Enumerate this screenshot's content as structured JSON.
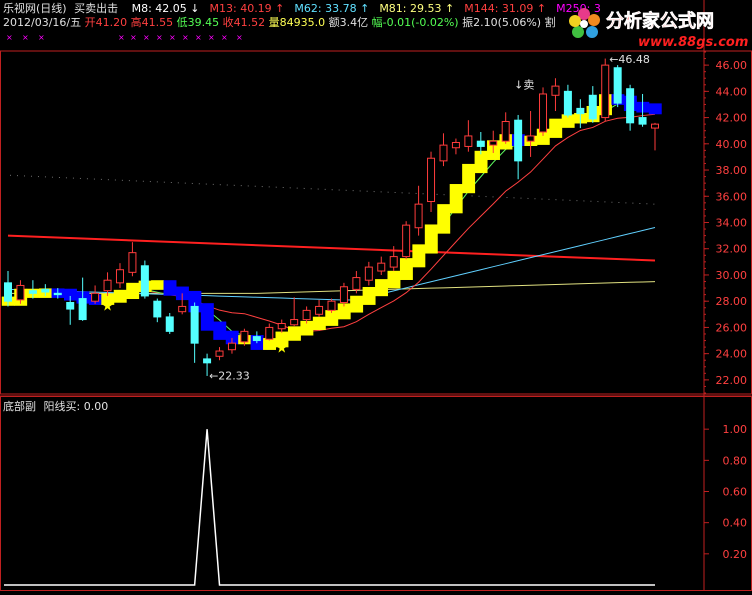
{
  "header": {
    "title": "乐视网(日线)",
    "indicator_name": "买卖出击",
    "ma": [
      {
        "label": "M8: 42.05",
        "arrow": "↓",
        "color": "#ffffff"
      },
      {
        "label": "M13: 40.19",
        "arrow": "↑",
        "color": "#ff4040"
      },
      {
        "label": "M62: 33.78",
        "arrow": "↑",
        "color": "#60e0ff"
      },
      {
        "label": "M81: 29.53",
        "arrow": "↑",
        "color": "#ffff80"
      },
      {
        "label": "M144: 31.09",
        "arrow": "↑",
        "color": "#ff4040"
      },
      {
        "label": "M250: 3",
        "arrow": "",
        "color": "#ff00ff"
      }
    ],
    "quote": {
      "date": "2012/03/16/五",
      "open": "开41.20",
      "high": "高41.55",
      "low": "低39.45",
      "close": "收41.52",
      "volume": "量84935.0",
      "amount": "额3.4亿",
      "change": "幅-0.01(-0.02%)",
      "amplitude": "振2.10(5.06%)",
      "tail": "割"
    }
  },
  "logo": {
    "text": "分析家公式网",
    "url": "www.88gs.com"
  },
  "annotations": {
    "high_label": "46.48",
    "low_label": "22.33",
    "sell_label": "↓卖",
    "star_glyph": "★"
  },
  "sub_panel": {
    "title": "底部副",
    "line_name": "阳线买",
    "value": "0.00"
  },
  "colors": {
    "up_candle": "#ff3c3c",
    "down_candle": "#54ffff",
    "axis": "#c02020",
    "ribbon_up": "#ffff00",
    "ribbon_down": "#0000ff",
    "ma144": "#ff2020",
    "ma62": "#60d0ff",
    "ma81": "#e0e080",
    "ma13": "#ff4040",
    "ma8": "#60ff60"
  },
  "chart_data": {
    "type": "candlestick",
    "ylim": [
      21.0,
      47.0
    ],
    "y_ticks": [
      "22.00",
      "24.00",
      "26.00",
      "28.00",
      "30.00",
      "32.00",
      "34.00",
      "36.00",
      "38.00",
      "40.00",
      "42.00",
      "44.00",
      "46.00"
    ],
    "candles": [
      {
        "o": 29.4,
        "h": 30.3,
        "l": 27.6,
        "c": 28.0
      },
      {
        "o": 28.1,
        "h": 29.6,
        "l": 27.8,
        "c": 29.2
      },
      {
        "o": 28.8,
        "h": 29.6,
        "l": 28.2,
        "c": 28.6
      },
      {
        "o": 28.9,
        "h": 29.3,
        "l": 28.4,
        "c": 28.7
      },
      {
        "o": 28.6,
        "h": 29.0,
        "l": 28.2,
        "c": 28.5
      },
      {
        "o": 27.9,
        "h": 28.4,
        "l": 26.2,
        "c": 27.4
      },
      {
        "o": 28.2,
        "h": 29.8,
        "l": 26.5,
        "c": 26.6
      },
      {
        "o": 28.0,
        "h": 29.2,
        "l": 27.8,
        "c": 28.6
      },
      {
        "o": 28.8,
        "h": 30.2,
        "l": 28.4,
        "c": 29.6
      },
      {
        "o": 29.4,
        "h": 30.9,
        "l": 29.0,
        "c": 30.4
      },
      {
        "o": 30.2,
        "h": 32.5,
        "l": 29.9,
        "c": 31.7
      },
      {
        "o": 30.7,
        "h": 31.1,
        "l": 28.2,
        "c": 28.4
      },
      {
        "o": 28.0,
        "h": 28.2,
        "l": 26.4,
        "c": 26.8
      },
      {
        "o": 26.8,
        "h": 27.1,
        "l": 25.5,
        "c": 25.7
      },
      {
        "o": 27.2,
        "h": 28.6,
        "l": 27.0,
        "c": 27.6
      },
      {
        "o": 27.6,
        "h": 27.9,
        "l": 23.3,
        "c": 24.8
      },
      {
        "o": 23.6,
        "h": 24.0,
        "l": 22.3,
        "c": 23.3
      },
      {
        "o": 23.8,
        "h": 24.5,
        "l": 23.5,
        "c": 24.2
      },
      {
        "o": 24.3,
        "h": 25.2,
        "l": 24.0,
        "c": 24.8
      },
      {
        "o": 24.9,
        "h": 25.9,
        "l": 24.6,
        "c": 25.7
      },
      {
        "o": 25.3,
        "h": 25.7,
        "l": 24.8,
        "c": 25.0
      },
      {
        "o": 25.1,
        "h": 26.3,
        "l": 25.0,
        "c": 26.0
      },
      {
        "o": 25.9,
        "h": 26.6,
        "l": 25.6,
        "c": 26.3
      },
      {
        "o": 26.2,
        "h": 28.3,
        "l": 26.1,
        "c": 26.6
      },
      {
        "o": 26.6,
        "h": 27.6,
        "l": 26.3,
        "c": 27.3
      },
      {
        "o": 27.0,
        "h": 28.1,
        "l": 26.8,
        "c": 27.6
      },
      {
        "o": 27.3,
        "h": 28.2,
        "l": 27.1,
        "c": 28.0
      },
      {
        "o": 27.9,
        "h": 29.4,
        "l": 27.6,
        "c": 29.1
      },
      {
        "o": 28.9,
        "h": 30.3,
        "l": 28.6,
        "c": 29.8
      },
      {
        "o": 29.6,
        "h": 31.0,
        "l": 29.2,
        "c": 30.6
      },
      {
        "o": 30.3,
        "h": 31.4,
        "l": 30.0,
        "c": 30.9
      },
      {
        "o": 30.6,
        "h": 32.2,
        "l": 30.3,
        "c": 31.4
      },
      {
        "o": 31.4,
        "h": 34.1,
        "l": 31.2,
        "c": 33.8
      },
      {
        "o": 33.6,
        "h": 36.8,
        "l": 33.0,
        "c": 35.4
      },
      {
        "o": 35.6,
        "h": 39.4,
        "l": 34.8,
        "c": 38.9
      },
      {
        "o": 38.7,
        "h": 40.8,
        "l": 38.3,
        "c": 39.9
      },
      {
        "o": 39.7,
        "h": 40.4,
        "l": 39.2,
        "c": 40.1
      },
      {
        "o": 39.8,
        "h": 41.8,
        "l": 39.4,
        "c": 40.6
      },
      {
        "o": 40.2,
        "h": 40.9,
        "l": 39.2,
        "c": 39.8
      },
      {
        "o": 39.9,
        "h": 41.0,
        "l": 39.3,
        "c": 40.2
      },
      {
        "o": 40.2,
        "h": 42.4,
        "l": 40.0,
        "c": 41.7
      },
      {
        "o": 41.8,
        "h": 42.2,
        "l": 37.3,
        "c": 38.7
      },
      {
        "o": 40.2,
        "h": 42.5,
        "l": 39.0,
        "c": 40.6
      },
      {
        "o": 40.9,
        "h": 44.3,
        "l": 40.6,
        "c": 43.8
      },
      {
        "o": 43.7,
        "h": 45.0,
        "l": 42.5,
        "c": 44.4
      },
      {
        "o": 44.0,
        "h": 44.5,
        "l": 42.0,
        "c": 42.2
      },
      {
        "o": 42.7,
        "h": 43.4,
        "l": 41.2,
        "c": 42.3
      },
      {
        "o": 43.7,
        "h": 44.4,
        "l": 41.6,
        "c": 41.9
      },
      {
        "o": 42.0,
        "h": 46.5,
        "l": 41.7,
        "c": 46.0
      },
      {
        "o": 45.8,
        "h": 46.0,
        "l": 42.8,
        "c": 43.1
      },
      {
        "o": 44.2,
        "h": 44.5,
        "l": 41.0,
        "c": 41.6
      },
      {
        "o": 42.0,
        "h": 43.8,
        "l": 41.3,
        "c": 41.5
      },
      {
        "o": 41.2,
        "h": 41.6,
        "l": 39.5,
        "c": 41.5
      }
    ],
    "sub_chart": {
      "ylim": [
        0,
        1.2
      ],
      "y_ticks": [
        "0.20",
        "0.40",
        "0.60",
        "0.80",
        "1.00"
      ],
      "values": [
        0,
        0,
        0,
        0,
        0,
        0,
        0,
        0,
        0,
        0,
        0,
        0,
        0,
        0,
        0,
        0,
        1,
        0,
        0,
        0,
        0,
        0,
        0,
        0,
        0,
        0,
        0,
        0,
        0,
        0,
        0,
        0,
        0,
        0,
        0,
        0,
        0,
        0,
        0,
        0,
        0,
        0,
        0,
        0,
        0,
        0,
        0,
        0,
        0,
        0,
        0,
        0,
        0
      ]
    }
  }
}
